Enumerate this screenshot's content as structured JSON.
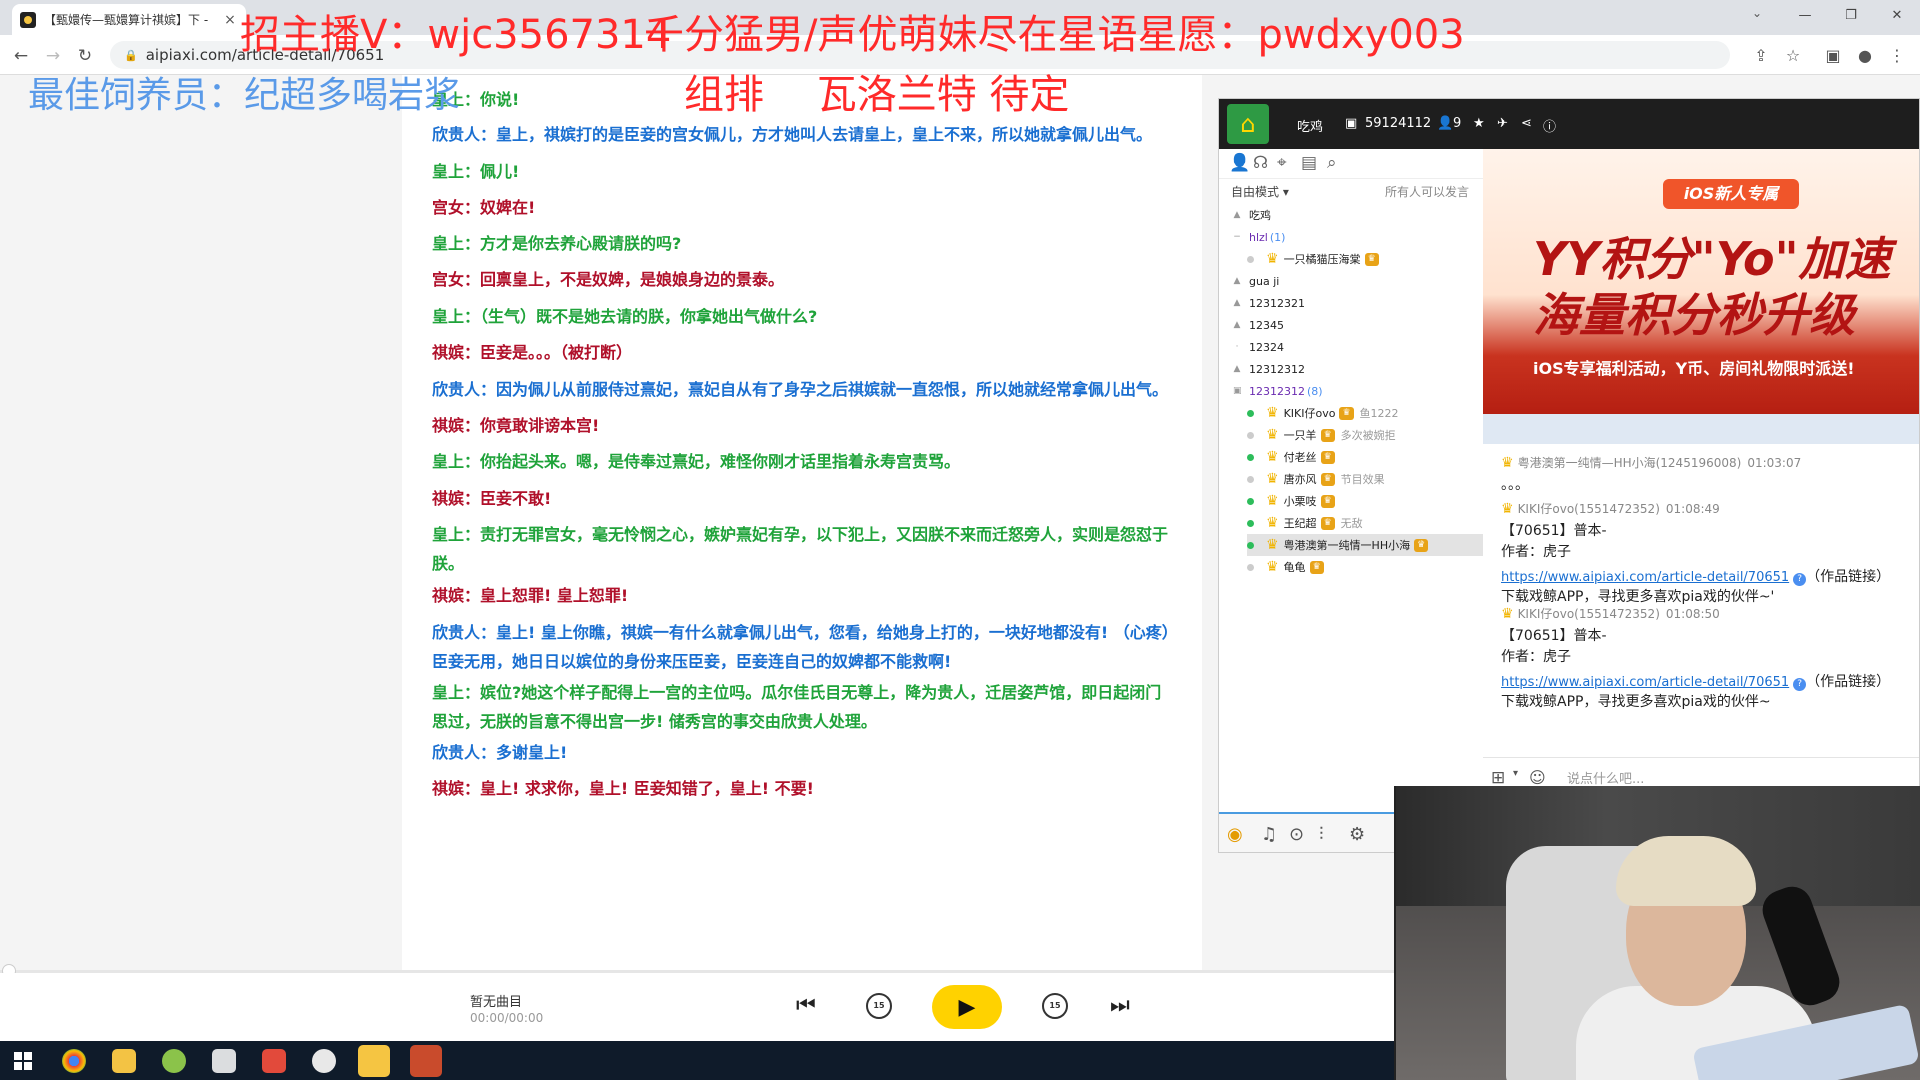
{
  "browser": {
    "tab_title": "【甄嬛传—甄嬛算计祺嫔】下 -",
    "tab_close": "×",
    "url": "aipiaxi.com/article-detail/70651"
  },
  "overlay": {
    "top_left": "招主播V：wjc3567314",
    "top_right": "千分猛男/声优萌妹尽在星语星愿：pwdxy003",
    "team": "组排　 瓦洛兰特 待定",
    "feeder": "最佳饲养员：纪超多喝岩浆"
  },
  "script_lines": [
    {
      "text": "皇上：你说!",
      "color": "green"
    },
    {
      "text": "欣贵人：皇上，祺嫔打的是臣妾的宫女佩儿，方才她叫人去请皇上，皇上不来，所以她就拿佩儿出气。",
      "color": "blue"
    },
    {
      "text": "皇上：佩儿!",
      "color": "green"
    },
    {
      "text": "宫女：奴婢在!",
      "color": "red"
    },
    {
      "text": "皇上：方才是你去养心殿请朕的吗?",
      "color": "green"
    },
    {
      "text": "宫女：回禀皇上，不是奴婢，是娘娘身边的景泰。",
      "color": "red"
    },
    {
      "text": "皇上：（生气）既不是她去请的朕，你拿她出气做什么?",
      "color": "green"
    },
    {
      "text": "祺嫔：臣妾是。。。（被打断）",
      "color": "red"
    },
    {
      "text": "欣贵人：因为佩儿从前服侍过熹妃，熹妃自从有了身孕之后祺嫔就一直怨恨，所以她就经常拿佩儿出气。",
      "color": "blue"
    },
    {
      "text": "祺嫔：你竟敢诽谤本宫!",
      "color": "red"
    },
    {
      "text": "皇上：你抬起头来。嗯，是侍奉过熹妃，难怪你刚才话里指着永寿宫责骂。",
      "color": "green"
    },
    {
      "text": "祺嫔：臣妾不敢!",
      "color": "red"
    },
    {
      "text": "皇上：责打无罪宫女，毫无怜悯之心，嫉妒熹妃有孕，以下犯上，又因朕不来而迁怒旁人，实则是怨怼于朕。",
      "color": "green"
    },
    {
      "text": "祺嫔：皇上恕罪! 皇上恕罪!",
      "color": "red"
    },
    {
      "text": "欣贵人：皇上! 皇上你瞧，祺嫔一有什么就拿佩儿出气，您看，给她身上打的，一块好地都没有! （心疼）臣妾无用，她日日以嫔位的身份来压臣妾，臣妾连自己的奴婢都不能救啊!",
      "color": "blue"
    },
    {
      "text": "皇上：嫔位?她这个样子配得上一宫的主位吗。瓜尔佳氏目无尊上，降为贵人，迁居姿芦馆，即日起闭门思过，无朕的旨意不得出宫一步! 储秀宫的事交由欣贵人处理。",
      "color": "green"
    },
    {
      "text": "欣贵人：多谢皇上!",
      "color": "blue"
    },
    {
      "text": "祺嫔：皇上! 求求你，皇上! 臣妾知错了，皇上! 不要!",
      "color": "red"
    }
  ],
  "yy": {
    "channel_name": "吃鸡",
    "channel_id": "59124112",
    "online": "9",
    "mode": "自由模式",
    "speak": "所有人可以发言",
    "tree": [
      {
        "pre": "▲",
        "name": "吃鸡",
        "type": "root"
      },
      {
        "pre": "−",
        "name": "hlzl",
        "count": "(1)",
        "type": "group"
      },
      {
        "pre": "",
        "name": "一只橘猫压海棠",
        "type": "member",
        "online": false
      },
      {
        "pre": "▲",
        "name": "gua ji",
        "type": "sub"
      },
      {
        "pre": "▲",
        "name": "12312321",
        "type": "sub"
      },
      {
        "pre": "▲",
        "name": "12345",
        "type": "sub"
      },
      {
        "pre": "·",
        "name": "12324",
        "type": "sub"
      },
      {
        "pre": "▲",
        "name": "12312312",
        "type": "sub"
      },
      {
        "pre": "▣",
        "name": "12312312",
        "count": "(8)",
        "type": "group"
      },
      {
        "name": "KIKI仔ovo",
        "extra": "鱼1222",
        "type": "member",
        "online": true
      },
      {
        "name": "一只羊",
        "extra": "多次被婉拒",
        "type": "member",
        "online": false
      },
      {
        "name": "付老丝",
        "extra": "",
        "type": "member",
        "online": true
      },
      {
        "name": "唐亦风",
        "extra": "节目效果",
        "type": "member",
        "online": false
      },
      {
        "name": "小栗吱",
        "extra": "",
        "type": "member",
        "online": true
      },
      {
        "name": "王纪超",
        "extra": "无敌",
        "type": "member",
        "online": true
      },
      {
        "name": "粤港澳第一纯情一HH小海",
        "extra": "",
        "type": "member",
        "online": true,
        "selected": true
      },
      {
        "name": "龟龟",
        "extra": "",
        "type": "member",
        "online": false
      }
    ],
    "banner": {
      "pill": "iOS新人专属",
      "line1": "YY积分\"Yo\"加速",
      "line2": "海量积分秒升级",
      "sub": "iOS专享福利活动，Y币、房间礼物限时派送!"
    },
    "chat": [
      {
        "name": "粤港澳第一纯情—HH小海(1245196008)",
        "time": "01:03:07",
        "lines": [
          "。。。"
        ]
      },
      {
        "name": "KIKI仔ovo(1551472352)",
        "time": "01:08:49",
        "lines": [
          "【70651】普本-",
          "作者：虎子"
        ],
        "link": "https://www.aipiaxi.com/article-detail/70651",
        "link_suffix": "（作品链接）",
        "tail": "下载戏鲸APP，寻找更多喜欢pia戏的伙伴~'"
      },
      {
        "name": "KIKI仔ovo(1551472352)",
        "time": "01:08:50",
        "lines": [
          "【70651】普本-",
          "作者：虎子"
        ],
        "link": "https://www.aipiaxi.com/article-detail/70651",
        "link_suffix": "（作品链接）",
        "tail": "下载戏鲸APP，寻找更多喜欢pia戏的伙伴~"
      }
    ],
    "chat_placeholder": "说点什么吧..."
  },
  "player": {
    "track": "暂无曲目",
    "time": "00:00/00:00",
    "skip_label": "15"
  }
}
